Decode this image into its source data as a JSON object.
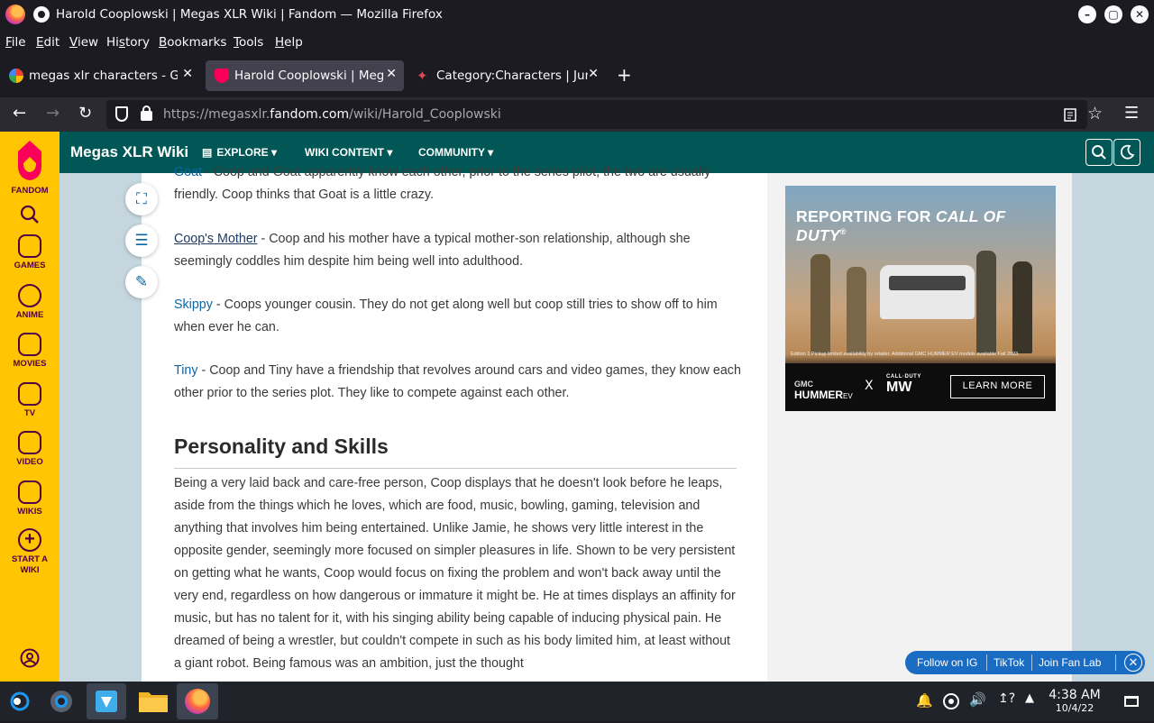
{
  "window": {
    "title": "Harold Cooplowski | Megas XLR Wiki | Fandom — Mozilla Firefox",
    "controls": [
      "–",
      "▢",
      "✕"
    ]
  },
  "menubar": [
    {
      "label": "File",
      "u": "F"
    },
    {
      "label": "Edit",
      "u": "E"
    },
    {
      "label": "View",
      "u": "V"
    },
    {
      "label": "History",
      "u": "s"
    },
    {
      "label": "Bookmarks",
      "u": "B"
    },
    {
      "label": "Tools",
      "u": "T"
    },
    {
      "label": "Help",
      "u": "H"
    }
  ],
  "tabs": [
    {
      "label": "megas xlr characters - Goo",
      "favicon": "google-icon",
      "active": false
    },
    {
      "label": "Harold Cooplowski | Mega",
      "favicon": "fandom-icon",
      "active": true
    },
    {
      "label": "Category:Characters | Juni",
      "favicon": "fandom-icon",
      "active": false
    }
  ],
  "tab_close": "✕",
  "new_tab": "+",
  "url": {
    "prefix": "https://megasxlr.",
    "domain": "fandom.com",
    "path": "/wiki/Harold_Cooplowski"
  },
  "fandom_sidebar": {
    "brand": "FANDOM",
    "items": [
      "GAMES",
      "ANIME",
      "MOVIES",
      "TV",
      "VIDEO",
      "WIKIS",
      "START A WIKI"
    ]
  },
  "wiki_header": {
    "name": "Megas XLR Wiki",
    "nav": [
      "EXPLORE",
      "WIKI CONTENT",
      "COMMUNITY"
    ]
  },
  "article": {
    "goat": {
      "name": "Goat",
      "text": " - Coop and Goat apparently know each other, prior to the series pilot, the two are usually friendly. Coop thinks that Goat is a little crazy."
    },
    "mother": {
      "name": "Coop's Mother",
      "text": " - Coop and his mother have a typical mother-son relationship, although she seemingly coddles him despite him being well into adulthood."
    },
    "skippy": {
      "name": "Skippy",
      "text": " - Coops younger cousin. They do not get along well but coop still tries to show off to him when ever he can."
    },
    "tiny": {
      "name": "Tiny",
      "text": " - Coop and Tiny have a friendship that revolves around cars and video games, they know each other prior to the series plot. They like to compete against each other."
    },
    "heading": "Personality and Skills",
    "personality": "Being a very laid back and care-free person, Coop displays that he doesn't look before he leaps, aside from the things which he loves, which are food, music, bowling, gaming, television and anything that involves him being entertained. Unlike Jamie, he shows very little interest in the opposite gender, seemingly more focused on simpler pleasures in life. Shown to be very persistent on getting what he wants, Coop would focus on fixing the problem and won't back away until the very end, regardless on how dangerous or immature it might be. He at times displays an affinity for music, but has no talent for it, with his singing ability being capable of inducing physical pain. He dreamed of being a wrestler, but couldn't compete in such as his body limited him, at least without a giant robot. Being famous was an ambition, just the thought"
  },
  "ad": {
    "headline_a": "REPORTING FOR ",
    "headline_b": "CALL OF DUTY",
    "headline_mark": "®",
    "fine_print": "Edition 1 Pickup limited availability by retailer. Additional GMC HUMMER EV models available Fall 2023.",
    "brand_gmc": "GMC",
    "brand_hummer": "HUMMER",
    "brand_ev": "EV",
    "x": "X",
    "brand_cod": "CALL·DUTY",
    "brand_mw": "MW",
    "cta": "LEARN MORE"
  },
  "follow_bar": [
    "Follow on IG",
    "TikTok",
    "Join Fan Lab"
  ],
  "clock": {
    "time": "4:38 AM",
    "date": "10/4/22"
  }
}
